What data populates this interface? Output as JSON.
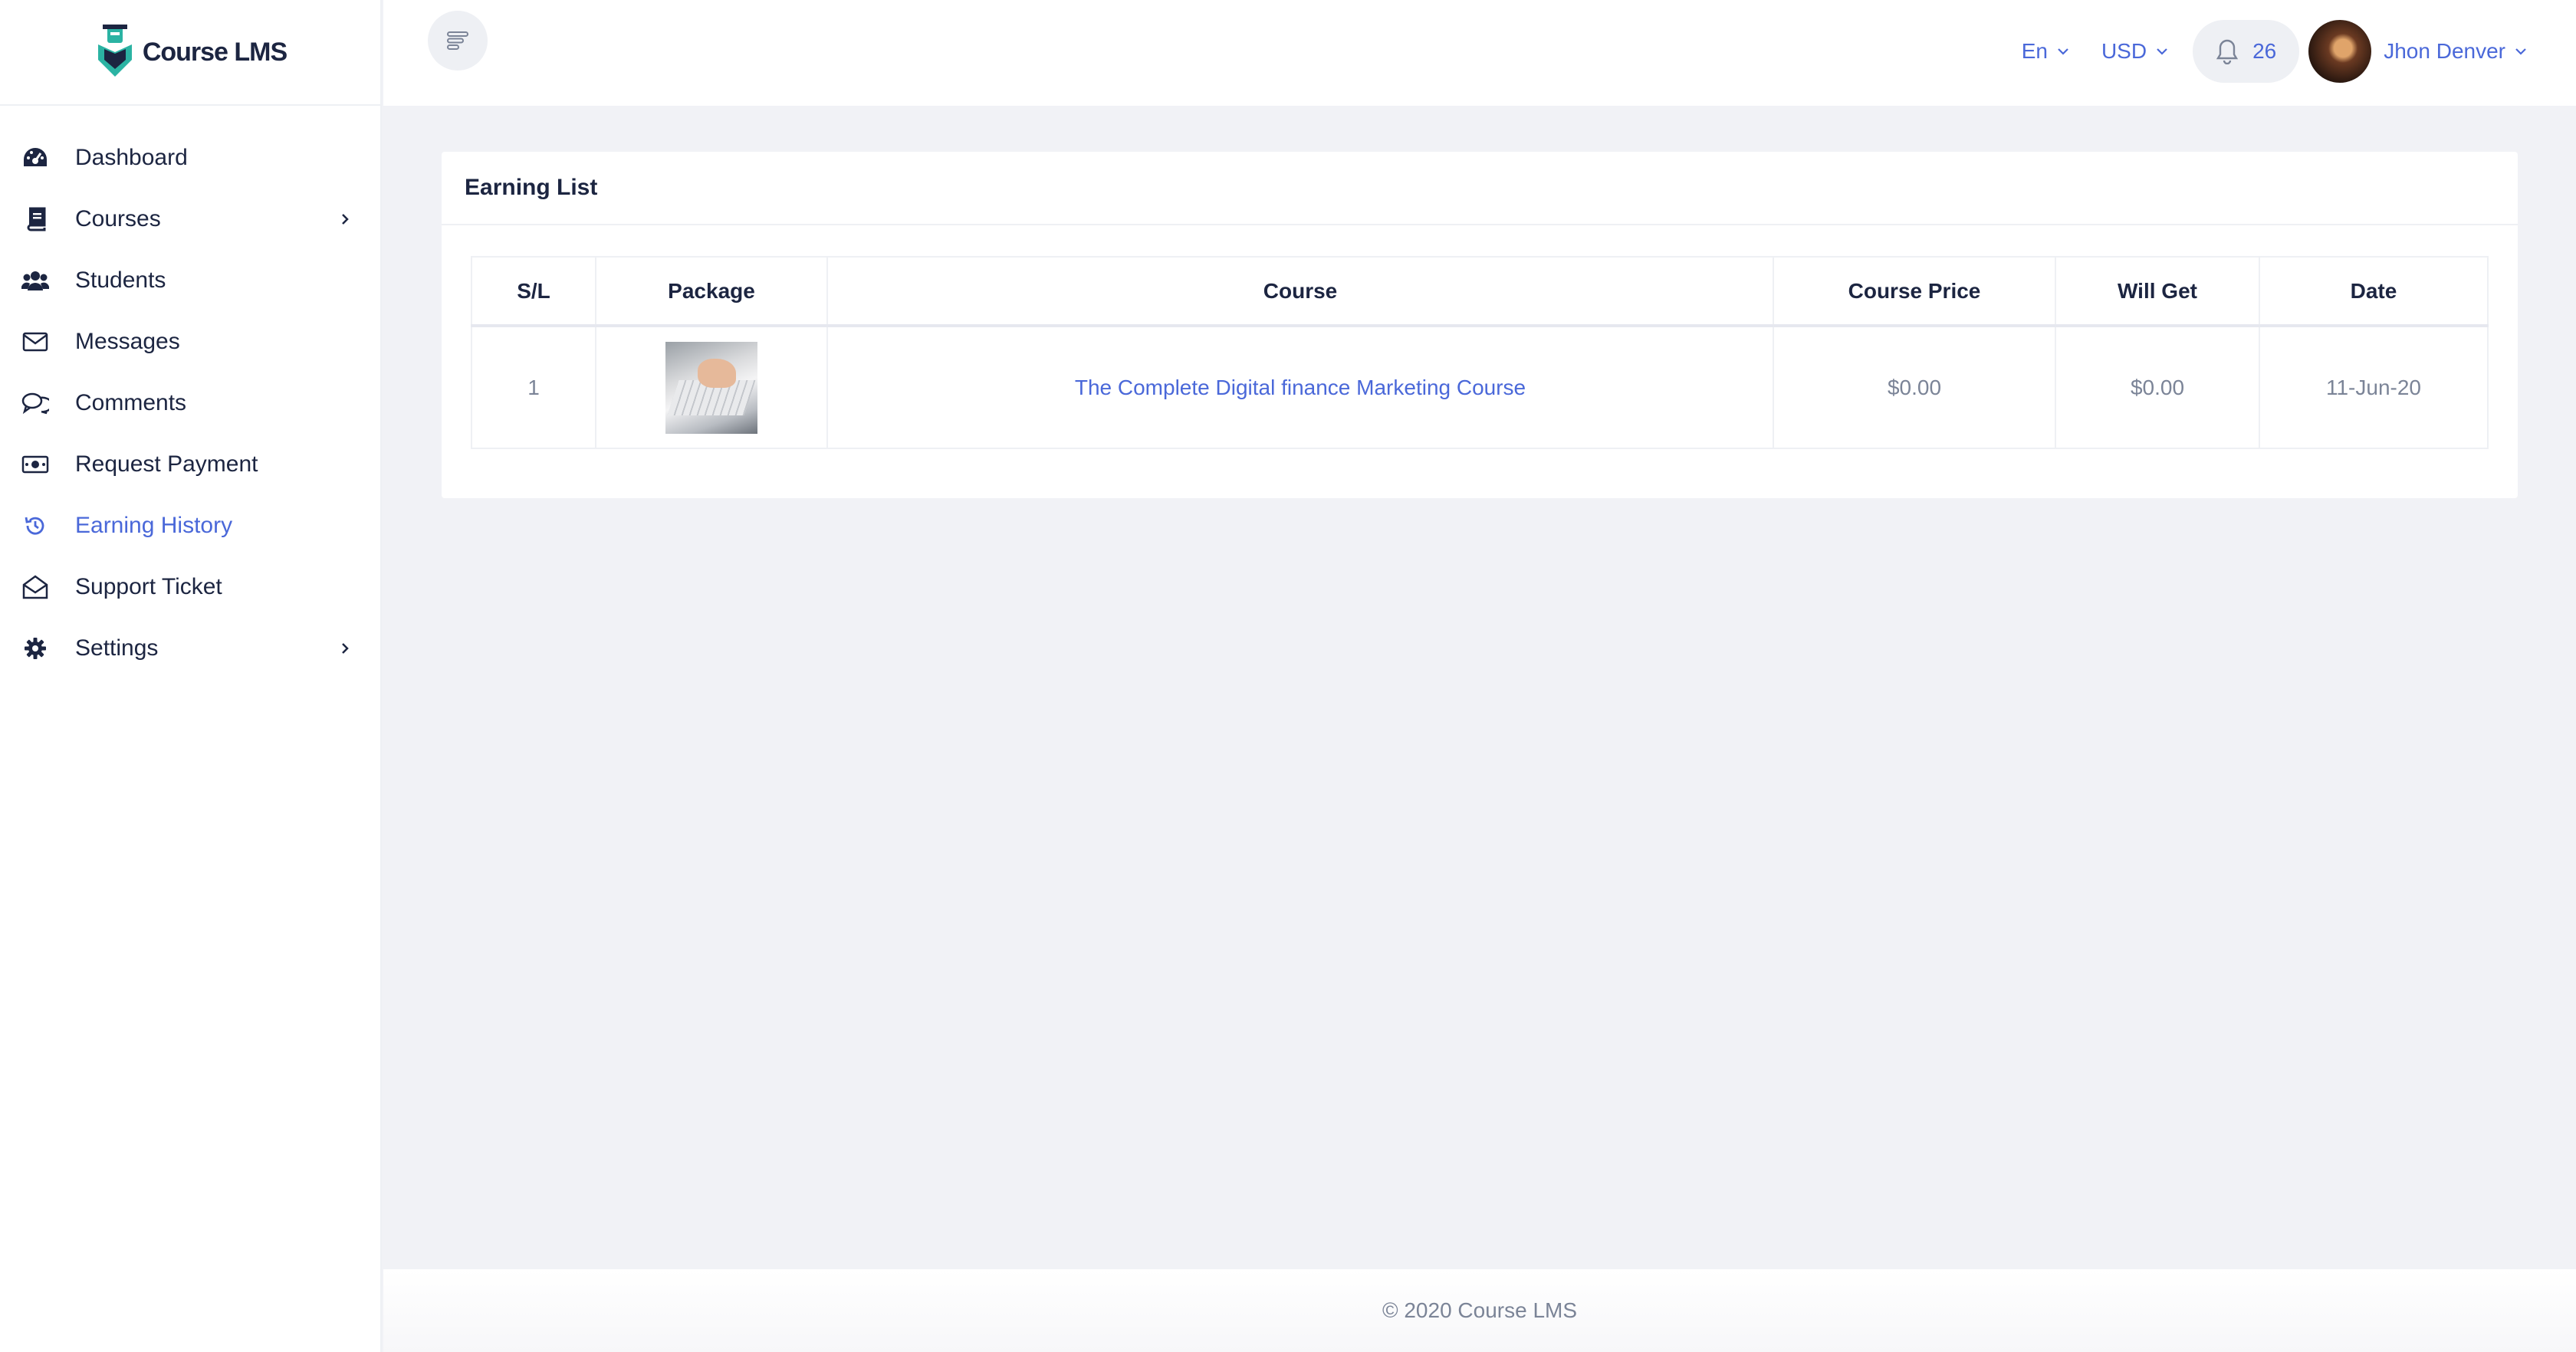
{
  "app": {
    "brand": "Course LMS"
  },
  "sidebar": {
    "items": [
      {
        "label": "Dashboard",
        "icon": "dashboard-icon"
      },
      {
        "label": "Courses",
        "icon": "book-icon",
        "has_submenu": true
      },
      {
        "label": "Students",
        "icon": "users-icon"
      },
      {
        "label": "Messages",
        "icon": "envelope-icon"
      },
      {
        "label": "Comments",
        "icon": "comments-icon"
      },
      {
        "label": "Request Payment",
        "icon": "money-icon"
      },
      {
        "label": "Earning History",
        "icon": "history-icon",
        "active": true
      },
      {
        "label": "Support Ticket",
        "icon": "envelope-open-icon"
      },
      {
        "label": "Settings",
        "icon": "gear-icon",
        "has_submenu": true
      }
    ]
  },
  "header": {
    "language": "En",
    "currency": "USD",
    "notifications_count": "26",
    "user_name": "Jhon Denver"
  },
  "main": {
    "card_title": "Earning List",
    "table": {
      "columns": [
        "S/L",
        "Package",
        "Course",
        "Course Price",
        "Will Get",
        "Date"
      ],
      "rows": [
        {
          "sl": "1",
          "package_image": "laptop-typing-thumbnail",
          "course": "The Complete Digital finance Marketing Course",
          "course_price": "$0.00",
          "will_get": "$0.00",
          "date": "11-Jun-20"
        }
      ]
    }
  },
  "footer": {
    "copyright": "© 2020 Course LMS"
  },
  "colors": {
    "accent": "#4a68d9",
    "text_dark": "#1c2541",
    "muted": "#7b8497",
    "background": "#f1f2f6",
    "logo_teal": "#2bb3a3"
  }
}
